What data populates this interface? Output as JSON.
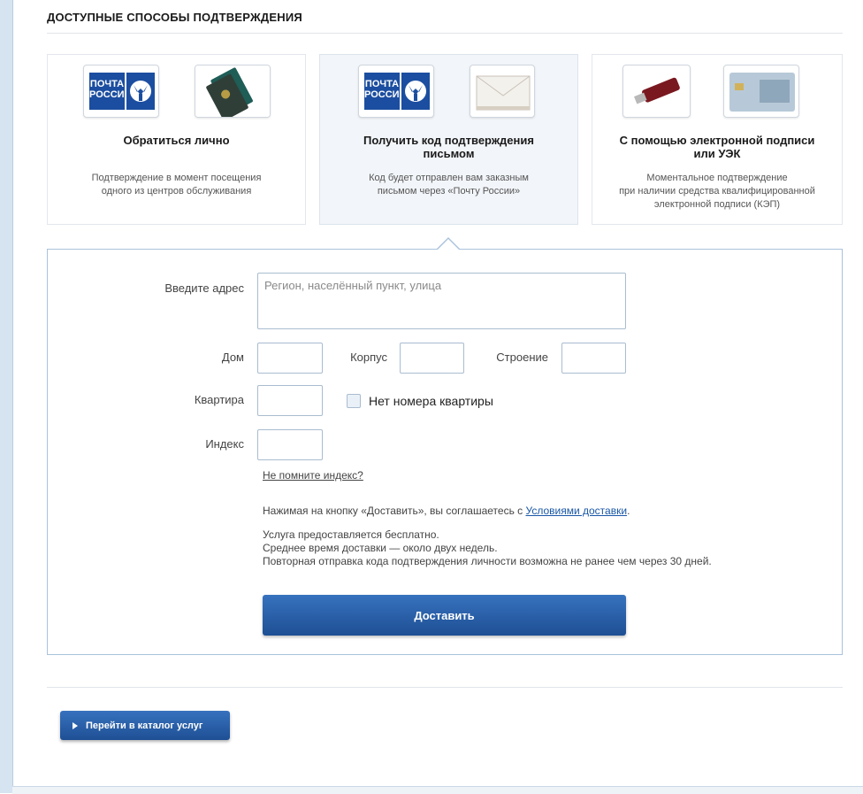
{
  "section": {
    "title": "ДОСТУПНЫЕ СПОСОБЫ ПОДТВЕРЖДЕНИЯ"
  },
  "logo_text": "ПОЧТА РОССИИ",
  "cards": [
    {
      "title": "Обратиться лично",
      "desc_lines": [
        "Подтверждение в момент посещения",
        "одного из центров обслуживания"
      ],
      "icons": [
        "pochta-rossii-logo-icon",
        "passport-icon"
      ]
    },
    {
      "title_lines": [
        "Получить код подтверждения",
        "письмом"
      ],
      "desc_lines": [
        "Код будет отправлен вам заказным",
        "письмом через «Почту России»"
      ],
      "icons": [
        "pochta-rossii-logo-icon",
        "envelope-icon"
      ],
      "selected": true
    },
    {
      "title_lines": [
        "С помощью электронной подписи",
        "или УЭК"
      ],
      "desc_lines": [
        "Моментальное подтверждение",
        "при наличии средства квалифицированной",
        "электронной подписи (КЭП)"
      ],
      "icons": [
        "usb-token-icon",
        "uek-card-icon"
      ]
    }
  ],
  "form": {
    "address_label": "Введите адрес",
    "address_placeholder": "Регион, населённый пункт, улица",
    "house_label": "Дом",
    "korpus_label": "Корпус",
    "building_label": "Строение",
    "apartment_label": "Квартира",
    "no_apartment_label": "Нет номера квартиры",
    "index_label": "Индекс",
    "forgot_index_link": "Не помните индекс?",
    "agreement_prefix": "Нажимая на кнопку «Доставить», вы соглашаетесь с ",
    "agreement_link": "Условиями доставки",
    "agreement_suffix": ".",
    "info_lines": [
      "Услуга предоставляется бесплатно.",
      "Среднее время доставки — около двух недель.",
      "Повторная отправка кода подтверждения личности возможна не ранее чем через 30 дней."
    ],
    "submit_label": "Доставить"
  },
  "catalog_button": "Перейти в каталог услуг",
  "colors": {
    "accent": "#1e4f94",
    "link": "#1a57a6",
    "card_selected_bg": "#f2f5f9",
    "form_border": "#a9c2dc"
  }
}
